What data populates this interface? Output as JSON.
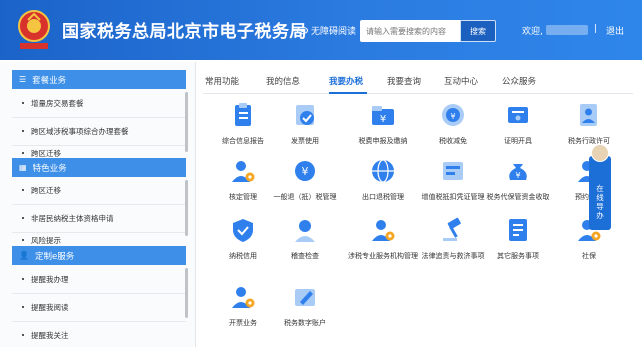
{
  "header": {
    "title": "国家税务总局北京市电子税务局",
    "accessibility_label": "无障碍阅读",
    "search_placeholder": "请输入需要搜索的内容",
    "search_button": "搜索",
    "welcome_label": "欢迎,",
    "separator": "|",
    "logout_label": "退出"
  },
  "sidebar": {
    "sections": [
      {
        "title": "套餐业务",
        "icon": "list-icon",
        "items": [
          "增量房交易套餐",
          "跨区域涉税事项综合办理套餐",
          "跨区迁移"
        ]
      },
      {
        "title": "特色业务",
        "icon": "grid-icon",
        "items": [
          "跨区迁移",
          "非居民纳税主体资格申请",
          "风险提示"
        ]
      },
      {
        "title": "定制e服务",
        "icon": "user-icon",
        "items": [
          "提醒我办理",
          "提醒我阅读",
          "提醒我关注"
        ]
      }
    ]
  },
  "tabs": [
    "常用功能",
    "我的信息",
    "我要办税",
    "我要查询",
    "互动中心",
    "公众服务"
  ],
  "active_tab": "我要办税",
  "services": [
    {
      "label": "综合信息报告",
      "icon": "clipboard-icon"
    },
    {
      "label": "发票使用",
      "icon": "invoice-check-icon"
    },
    {
      "label": "税费申报及缴纳",
      "icon": "yen-folder-icon"
    },
    {
      "label": "税收减免",
      "icon": "tax-reduction-icon"
    },
    {
      "label": "证明开具",
      "icon": "certificate-icon"
    },
    {
      "label": "税务行政许可",
      "icon": "document-person-icon"
    },
    {
      "label": "核定管理",
      "icon": "user-gear-icon"
    },
    {
      "label": "一般退（抵）税管理",
      "icon": "yen-refund-icon"
    },
    {
      "label": "出口退税管理",
      "icon": "globe-icon"
    },
    {
      "label": "增值税抵扣凭证管理",
      "icon": "voucher-icon"
    },
    {
      "label": "税务代保管资金收取",
      "icon": "money-bag-icon"
    },
    {
      "label": "预约定价",
      "icon": "user-clock-icon"
    },
    {
      "label": "纳税信用",
      "icon": "shield-check-icon"
    },
    {
      "label": "稽查检查",
      "icon": "inspector-icon"
    },
    {
      "label": "涉税专业服务机构管理",
      "icon": "user-gear-icon"
    },
    {
      "label": "法律追责与救济事项",
      "icon": "gavel-icon"
    },
    {
      "label": "其它服务事项",
      "icon": "document-list-icon"
    },
    {
      "label": "社保",
      "icon": "user-gear-icon"
    },
    {
      "label": "开票业务",
      "icon": "user-gear-icon"
    },
    {
      "label": "税务数字账户",
      "icon": "pen-account-icon"
    }
  ],
  "float_widget": {
    "text": "在线导办"
  },
  "colors": {
    "brand": "#1d6fd8",
    "header": "#2b7be0",
    "icon_blue": "#2f80ed",
    "icon_light": "#a9ccf6",
    "icon_orange": "#f5a623"
  }
}
